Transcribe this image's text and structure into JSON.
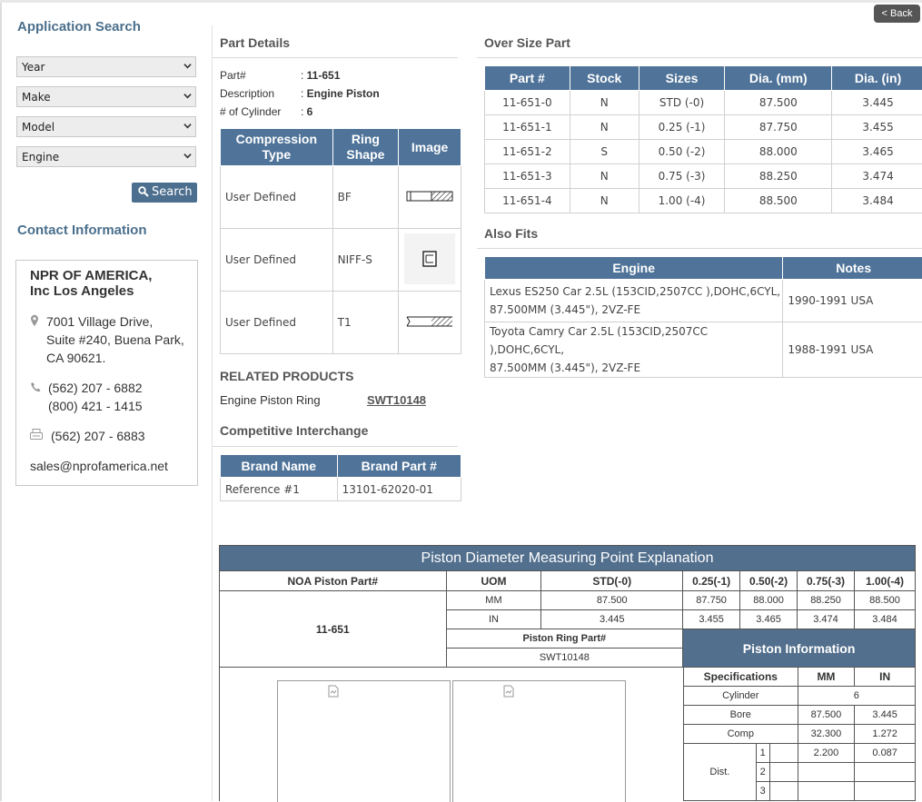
{
  "back_label": "< Back",
  "sidebar": {
    "app_search_title": "Application Search",
    "selects": [
      "Year",
      "Make",
      "Model",
      "Engine"
    ],
    "search_label": "Search",
    "contact_title": "Contact Information",
    "company_line1": "NPR OF AMERICA,",
    "company_line2": "Inc Los Angeles",
    "address": [
      "7001 Village Drive,",
      "Suite #240, Buena Park,",
      "CA 90621."
    ],
    "phones": [
      "(562) 207 - 6882",
      "(800) 421 - 1415"
    ],
    "fax": "(562) 207 - 6883",
    "email": "sales@nprofamerica.net"
  },
  "part_details": {
    "title": "Part Details",
    "part_label": "Part#",
    "part_value": "11-651",
    "desc_label": "Description",
    "desc_value": "Engine Piston",
    "cyl_label": "# of Cylinder",
    "cyl_value": "6",
    "ring_headers": [
      "Compression Type",
      "Ring Shape",
      "Image"
    ],
    "rings": [
      {
        "type": "User Defined",
        "shape": "BF",
        "image": "ring-bf-icon"
      },
      {
        "type": "User Defined",
        "shape": "NIFF-S",
        "image": "ring-niff-s-icon"
      },
      {
        "type": "User Defined",
        "shape": "T1",
        "image": "ring-t1-icon"
      }
    ]
  },
  "related": {
    "title": "RELATED PRODUCTS",
    "label": "Engine Piston Ring",
    "link": "SWT10148"
  },
  "interchange": {
    "title": "Competitive Interchange",
    "headers": [
      "Brand Name",
      "Brand Part #"
    ],
    "rows": [
      [
        "Reference #1",
        "13101-62020-01"
      ]
    ]
  },
  "oversize": {
    "title": "Over Size Part",
    "headers": [
      "Part #",
      "Stock",
      "Sizes",
      "Dia. (mm)",
      "Dia. (in)"
    ],
    "rows": [
      [
        "11-651-0",
        "N",
        "STD (-0)",
        "87.500",
        "3.445"
      ],
      [
        "11-651-1",
        "N",
        "0.25 (-1)",
        "87.750",
        "3.455"
      ],
      [
        "11-651-2",
        "S",
        "0.50 (-2)",
        "88.000",
        "3.465"
      ],
      [
        "11-651-3",
        "N",
        "0.75 (-3)",
        "88.250",
        "3.474"
      ],
      [
        "11-651-4",
        "N",
        "1.00 (-4)",
        "88.500",
        "3.484"
      ]
    ]
  },
  "also_fits": {
    "title": "Also Fits",
    "headers": [
      "Engine",
      "Notes"
    ],
    "rows": [
      {
        "engine1": "Lexus ES250 Car 2.5L (153CID,2507CC ),DOHC,6CYL,",
        "engine2": "87.500MM (3.445\"), 2VZ-FE",
        "notes": "1990-1991 USA"
      },
      {
        "engine1": "Toyota Camry Car 2.5L (153CID,2507CC ),DOHC,6CYL,",
        "engine2": "87.500MM (3.445\"), 2VZ-FE",
        "notes": "1988-1991 USA"
      }
    ]
  },
  "measure": {
    "title": "Piston Diameter Measuring Point Explanation",
    "headers": [
      "NOA Piston Part#",
      "UOM",
      "STD(-0)",
      "0.25(-1)",
      "0.50(-2)",
      "0.75(-3)",
      "1.00(-4)"
    ],
    "part": "11-651",
    "mm_row": [
      "MM",
      "87.500",
      "87.750",
      "88.000",
      "88.250",
      "88.500"
    ],
    "in_row": [
      "IN",
      "3.445",
      "3.455",
      "3.465",
      "3.474",
      "3.484"
    ],
    "ring_part_label": "Piston Ring Part#",
    "ring_part_value": "SWT10148",
    "info_title": "Piston Information",
    "info_headers": [
      "Specifications",
      "MM",
      "IN"
    ],
    "cylinder_label": "Cylinder",
    "cylinder_value": "6",
    "bore": [
      "Bore",
      "87.500",
      "3.445"
    ],
    "comp": [
      "Comp",
      "32.300",
      "1.272"
    ],
    "dist_label": "Dist.",
    "dist_rows": [
      [
        "1",
        "2.200",
        "0.087"
      ],
      [
        "2",
        "",
        ""
      ],
      [
        "3",
        "",
        ""
      ]
    ]
  }
}
